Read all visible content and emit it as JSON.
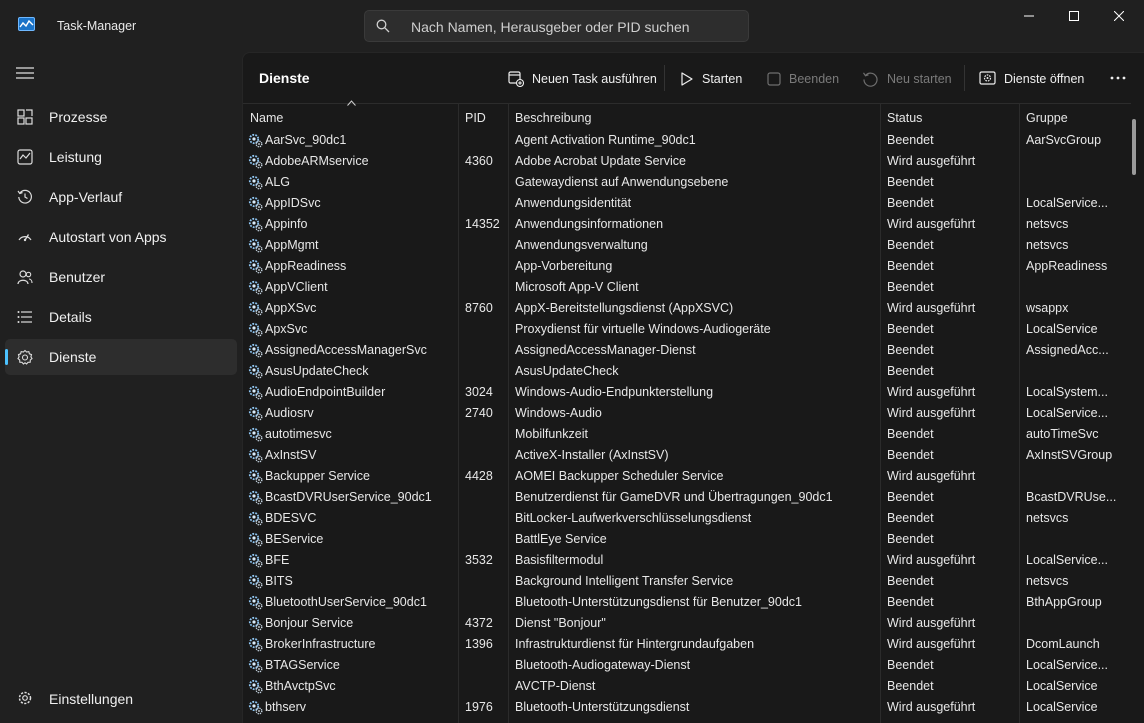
{
  "window": {
    "title": "Task-Manager",
    "search_placeholder": "Nach Namen, Herausgeber oder PID suchen"
  },
  "sidebar": {
    "items": [
      {
        "label": "Prozesse",
        "icon": "processes-icon"
      },
      {
        "label": "Leistung",
        "icon": "performance-icon"
      },
      {
        "label": "App-Verlauf",
        "icon": "history-icon"
      },
      {
        "label": "Autostart von Apps",
        "icon": "startup-icon"
      },
      {
        "label": "Benutzer",
        "icon": "users-icon"
      },
      {
        "label": "Details",
        "icon": "details-icon"
      },
      {
        "label": "Dienste",
        "icon": "services-icon",
        "active": true
      }
    ],
    "settings_label": "Einstellungen"
  },
  "toolbar": {
    "title": "Dienste",
    "run_task": "Neuen Task ausführen",
    "start": "Starten",
    "stop": "Beenden",
    "restart": "Neu starten",
    "open_services": "Dienste öffnen"
  },
  "table": {
    "columns": [
      "Name",
      "PID",
      "Beschreibung",
      "Status",
      "Gruppe"
    ],
    "sorted_column": "Name",
    "rows": [
      [
        "AarSvc_90dc1",
        "",
        "Agent Activation Runtime_90dc1",
        "Beendet",
        "AarSvcGroup"
      ],
      [
        "AdobeARMservice",
        "4360",
        "Adobe Acrobat Update Service",
        "Wird ausgeführt",
        ""
      ],
      [
        "ALG",
        "",
        "Gatewaydienst auf Anwendungsebene",
        "Beendet",
        ""
      ],
      [
        "AppIDSvc",
        "",
        "Anwendungsidentität",
        "Beendet",
        "LocalService..."
      ],
      [
        "Appinfo",
        "14352",
        "Anwendungsinformationen",
        "Wird ausgeführt",
        "netsvcs"
      ],
      [
        "AppMgmt",
        "",
        "Anwendungsverwaltung",
        "Beendet",
        "netsvcs"
      ],
      [
        "AppReadiness",
        "",
        "App-Vorbereitung",
        "Beendet",
        "AppReadiness"
      ],
      [
        "AppVClient",
        "",
        "Microsoft App-V Client",
        "Beendet",
        ""
      ],
      [
        "AppXSvc",
        "8760",
        "AppX-Bereitstellungsdienst (AppXSVC)",
        "Wird ausgeführt",
        "wsappx"
      ],
      [
        "ApxSvc",
        "",
        "Proxydienst für virtuelle Windows-Audiogeräte",
        "Beendet",
        "LocalService"
      ],
      [
        "AssignedAccessManagerSvc",
        "",
        "AssignedAccessManager-Dienst",
        "Beendet",
        "AssignedAcc..."
      ],
      [
        "AsusUpdateCheck",
        "",
        "AsusUpdateCheck",
        "Beendet",
        ""
      ],
      [
        "AudioEndpointBuilder",
        "3024",
        "Windows-Audio-Endpunkterstellung",
        "Wird ausgeführt",
        "LocalSystem..."
      ],
      [
        "Audiosrv",
        "2740",
        "Windows-Audio",
        "Wird ausgeführt",
        "LocalService..."
      ],
      [
        "autotimesvc",
        "",
        "Mobilfunkzeit",
        "Beendet",
        "autoTimeSvc"
      ],
      [
        "AxInstSV",
        "",
        "ActiveX-Installer (AxInstSV)",
        "Beendet",
        "AxInstSVGroup"
      ],
      [
        "Backupper Service",
        "4428",
        "AOMEI Backupper Scheduler Service",
        "Wird ausgeführt",
        ""
      ],
      [
        "BcastDVRUserService_90dc1",
        "",
        "Benutzerdienst für GameDVR und Übertragungen_90dc1",
        "Beendet",
        "BcastDVRUse..."
      ],
      [
        "BDESVC",
        "",
        "BitLocker-Laufwerkverschlüsselungsdienst",
        "Beendet",
        "netsvcs"
      ],
      [
        "BEService",
        "",
        "BattlEye Service",
        "Beendet",
        ""
      ],
      [
        "BFE",
        "3532",
        "Basisfiltermodul",
        "Wird ausgeführt",
        "LocalService..."
      ],
      [
        "BITS",
        "",
        "Background Intelligent Transfer Service",
        "Beendet",
        "netsvcs"
      ],
      [
        "BluetoothUserService_90dc1",
        "",
        "Bluetooth-Unterstützungsdienst für Benutzer_90dc1",
        "Beendet",
        "BthAppGroup"
      ],
      [
        "Bonjour Service",
        "4372",
        "Dienst \"Bonjour\"",
        "Wird ausgeführt",
        ""
      ],
      [
        "BrokerInfrastructure",
        "1396",
        "Infrastrukturdienst für Hintergrundaufgaben",
        "Wird ausgeführt",
        "DcomLaunch"
      ],
      [
        "BTAGService",
        "",
        "Bluetooth-Audiogateway-Dienst",
        "Beendet",
        "LocalService..."
      ],
      [
        "BthAvctpSvc",
        "",
        "AVCTP-Dienst",
        "Beendet",
        "LocalService"
      ],
      [
        "bthserv",
        "1976",
        "Bluetooth-Unterstützungsdienst",
        "Wird ausgeführt",
        "LocalService"
      ]
    ]
  },
  "colors": {
    "accent": "#4cc2ff",
    "window_bg": "#202020",
    "panel_bg": "#191919"
  }
}
